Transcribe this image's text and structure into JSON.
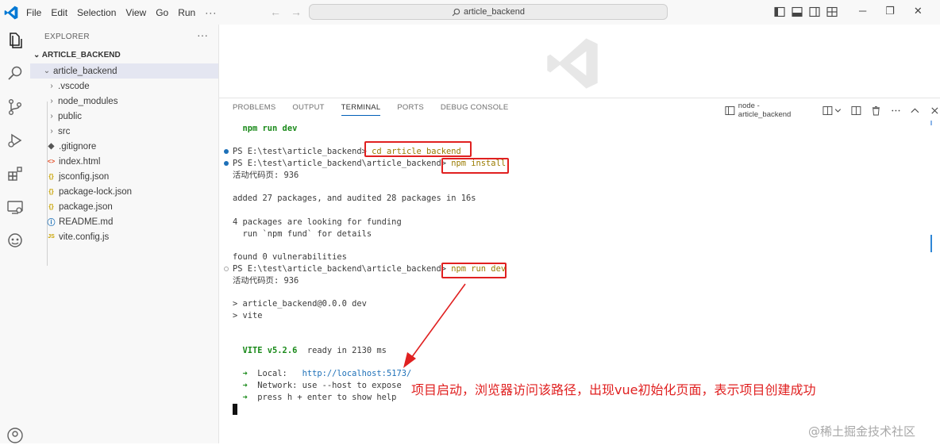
{
  "menu": {
    "items": [
      "File",
      "Edit",
      "Selection",
      "View",
      "Go",
      "Run",
      "···"
    ]
  },
  "titlebar": {
    "search_text": "article_backend"
  },
  "explorer": {
    "header": "EXPLORER",
    "more": "···",
    "root": "ARTICLE_BACKEND",
    "items": [
      {
        "label": "article_backend",
        "chev": "⌄",
        "icon": ""
      },
      {
        "label": ".vscode",
        "chev": "›",
        "icon": ""
      },
      {
        "label": "node_modules",
        "chev": "›",
        "icon": ""
      },
      {
        "label": "public",
        "chev": "›",
        "icon": ""
      },
      {
        "label": "src",
        "chev": "›",
        "icon": ""
      },
      {
        "label": ".gitignore",
        "chev": "",
        "icon": "◆"
      },
      {
        "label": "index.html",
        "chev": "",
        "icon": "<>"
      },
      {
        "label": "jsconfig.json",
        "chev": "",
        "icon": "{}"
      },
      {
        "label": "package-lock.json",
        "chev": "",
        "icon": "{}"
      },
      {
        "label": "package.json",
        "chev": "",
        "icon": "{}"
      },
      {
        "label": "README.md",
        "chev": "",
        "icon": "ⓘ"
      },
      {
        "label": "vite.config.js",
        "chev": "",
        "icon": "JS"
      }
    ]
  },
  "panel": {
    "tabs": [
      "PROBLEMS",
      "OUTPUT",
      "TERMINAL",
      "PORTS",
      "DEBUG CONSOLE"
    ],
    "terminal_name": "node - article_backend"
  },
  "terminal": {
    "l01": "  npm run dev",
    "l02_prompt": "PS E:\\test\\article_backend> ",
    "l02_cmd": "cd article_backend",
    "l03_prompt": "PS E:\\test\\article_backend\\article_backend> ",
    "l03_cmd": "npm install",
    "l04": "活动代码页: 936",
    "l05": "added 27 packages, and audited 28 packages in 16s",
    "l06": "4 packages are looking for funding",
    "l07": "  run `npm fund` for details",
    "l08": "found 0 vulnerabilities",
    "l09_prompt": "PS E:\\test\\article_backend\\article_backend> ",
    "l09_cmd": "npm run dev",
    "l10": "活动代码页: 936",
    "l11": "> article_backend@0.0.0 dev",
    "l12": "> vite",
    "vite_name": "  VITE v5.2.6",
    "vite_ready": "  ready in 2130 ms",
    "arrow": "  ➜  ",
    "local_label": "Local:   ",
    "local_url": "http://localhost:5173/",
    "network_label": "Network:",
    "network_text": " use --host to expose",
    "help_text": "press h + enter to show help"
  },
  "annotation": "项目启动，浏览器访问该路径，出现vue初始化页面，表示项目创建成功",
  "watermark": "@稀土掘金技术社区",
  "colors": {
    "accent": "#005fb8",
    "highlight_box": "#e02020",
    "terminal_green": "#1a8a1a"
  }
}
